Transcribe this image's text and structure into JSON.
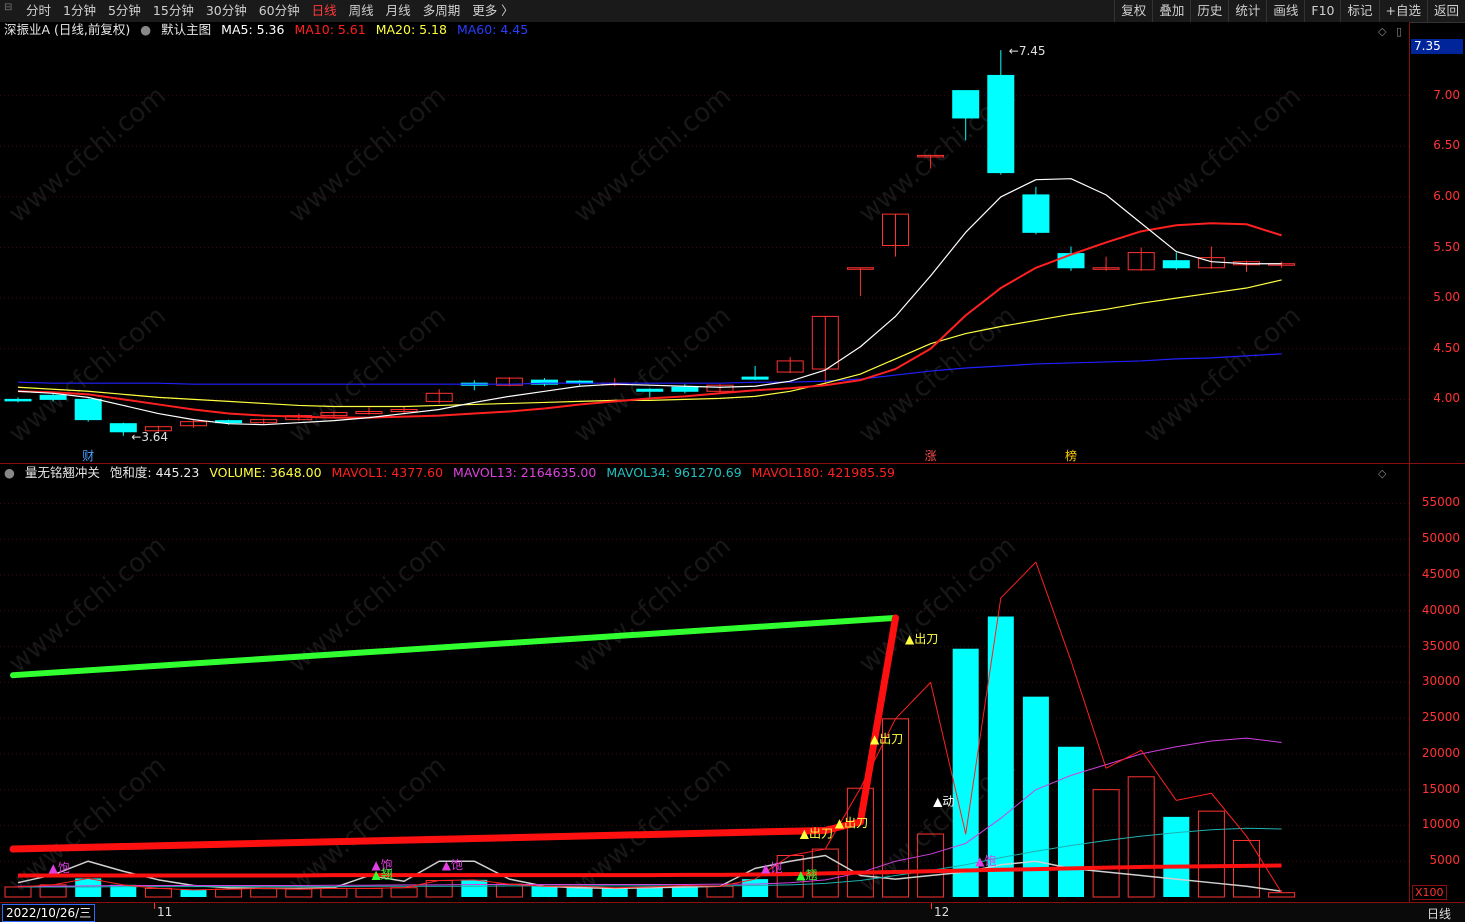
{
  "toolbar": {
    "timeframes": [
      "分时",
      "1分钟",
      "5分钟",
      "15分钟",
      "30分钟",
      "60分钟",
      "日线",
      "周线",
      "月线",
      "多周期",
      "更多 〉"
    ],
    "active": "日线",
    "right_buttons": [
      "复权",
      "叠加",
      "历史",
      "统计",
      "画线",
      "F10",
      "标记",
      "+自选",
      "返回"
    ]
  },
  "main_legend": {
    "stock": "深振业A (日线,前复权)",
    "chart_name": "默认主图",
    "ma5": "MA5: 5.36",
    "ma10": "MA10: 5.61",
    "ma20": "MA20: 5.18",
    "ma60": "MA60: 4.45"
  },
  "sub_legend": {
    "indicator": "量无铭翘冲关",
    "saturation": "饱和度: 445.23",
    "volume": "VOLUME: 3648.00",
    "mavol1": "MAVOL1: 4377.60",
    "mavol13": "MAVOL13: 2164635.00",
    "mavol34": "MAVOL34: 961270.69",
    "mavol180": "MAVOL180: 421985.59"
  },
  "price_axis": [
    "7.00",
    "6.50",
    "6.00",
    "5.50",
    "5.00",
    "4.50",
    "4.00"
  ],
  "last_price": "7.35",
  "volume_axis": [
    "55000",
    "50000",
    "45000",
    "40000",
    "35000",
    "30000",
    "25000",
    "20000",
    "15000",
    "10000",
    "5000"
  ],
  "volume_unit": "X100",
  "annotations": {
    "high": "7.45",
    "low": "3.64",
    "marks": [
      "财",
      "涨",
      "榜"
    ],
    "sig_chudao": "出刀",
    "sig_dong": "动",
    "sig_bao": "饱",
    "sig_qiao": "翘"
  },
  "dates": {
    "current": "2022/10/26/三",
    "m11": "11",
    "m12": "12"
  },
  "period_label": "日线",
  "watermark": "www.cfchi.com",
  "colors": {
    "up": "#ff3232",
    "down": "#00ffff",
    "ma5": "#ffffff",
    "ma10": "#ff2020",
    "ma20": "#ffff40",
    "ma60": "#2020ff"
  },
  "chart_data": {
    "type": "candlestick",
    "price_candles": [
      {
        "o": 4.0,
        "c": 3.99,
        "h": 4.02,
        "l": 3.97
      },
      {
        "o": 4.04,
        "c": 4.0,
        "h": 4.06,
        "l": 3.98
      },
      {
        "o": 4.0,
        "c": 3.8,
        "h": 4.01,
        "l": 3.78
      },
      {
        "o": 3.76,
        "c": 3.68,
        "h": 3.77,
        "l": 3.64
      },
      {
        "o": 3.69,
        "c": 3.73,
        "h": 3.74,
        "l": 3.67
      },
      {
        "o": 3.74,
        "c": 3.78,
        "h": 3.8,
        "l": 3.72
      },
      {
        "o": 3.79,
        "c": 3.77,
        "h": 3.8,
        "l": 3.75
      },
      {
        "o": 3.77,
        "c": 3.8,
        "h": 3.81,
        "l": 3.75
      },
      {
        "o": 3.8,
        "c": 3.84,
        "h": 3.86,
        "l": 3.79
      },
      {
        "o": 3.84,
        "c": 3.87,
        "h": 3.88,
        "l": 3.82
      },
      {
        "o": 3.86,
        "c": 3.88,
        "h": 3.92,
        "l": 3.85
      },
      {
        "o": 3.88,
        "c": 3.9,
        "h": 3.93,
        "l": 3.86
      },
      {
        "o": 3.98,
        "c": 4.06,
        "h": 4.1,
        "l": 3.96
      },
      {
        "o": 4.16,
        "c": 4.14,
        "h": 4.19,
        "l": 4.09
      },
      {
        "o": 4.14,
        "c": 4.21,
        "h": 4.22,
        "l": 4.13
      },
      {
        "o": 4.19,
        "c": 4.15,
        "h": 4.21,
        "l": 4.13
      },
      {
        "o": 4.18,
        "c": 4.16,
        "h": 4.19,
        "l": 4.14
      },
      {
        "o": 4.15,
        "c": 4.16,
        "h": 4.21,
        "l": 4.13
      },
      {
        "o": 4.1,
        "c": 4.08,
        "h": 4.11,
        "l": 4.02
      },
      {
        "o": 4.12,
        "c": 4.08,
        "h": 4.15,
        "l": 4.06
      },
      {
        "o": 4.08,
        "c": 4.14,
        "h": 4.15,
        "l": 4.07
      },
      {
        "o": 4.22,
        "c": 4.2,
        "h": 4.33,
        "l": 4.19
      },
      {
        "o": 4.27,
        "c": 4.38,
        "h": 4.42,
        "l": 4.26
      },
      {
        "o": 4.3,
        "c": 4.82,
        "h": 4.82,
        "l": 4.15
      },
      {
        "o": 5.3,
        "c": 5.3,
        "h": 5.3,
        "l": 5.02
      },
      {
        "o": 5.52,
        "c": 5.83,
        "h": 5.83,
        "l": 5.41
      },
      {
        "o": 6.41,
        "c": 6.41,
        "h": 6.41,
        "l": 6.28
      },
      {
        "o": 7.05,
        "c": 6.78,
        "h": 7.05,
        "l": 6.56
      },
      {
        "o": 7.2,
        "c": 6.24,
        "h": 7.45,
        "l": 6.22
      },
      {
        "o": 6.02,
        "c": 5.65,
        "h": 6.1,
        "l": 5.63
      },
      {
        "o": 5.44,
        "c": 5.3,
        "h": 5.51,
        "l": 5.27
      },
      {
        "o": 5.29,
        "c": 5.3,
        "h": 5.41,
        "l": 5.27
      },
      {
        "o": 5.28,
        "c": 5.45,
        "h": 5.5,
        "l": 5.27
      },
      {
        "o": 5.37,
        "c": 5.3,
        "h": 5.45,
        "l": 5.28
      },
      {
        "o": 5.3,
        "c": 5.4,
        "h": 5.51,
        "l": 5.29
      },
      {
        "o": 5.33,
        "c": 5.36,
        "h": 5.37,
        "l": 5.26
      },
      {
        "o": 5.34,
        "c": 5.34,
        "h": 5.36,
        "l": 5.3
      }
    ],
    "ma5": [
      4.08,
      4.06,
      4.02,
      3.94,
      3.86,
      3.8,
      3.76,
      3.75,
      3.77,
      3.79,
      3.82,
      3.86,
      3.9,
      3.97,
      4.03,
      4.08,
      4.13,
      4.15,
      4.14,
      4.13,
      4.12,
      4.13,
      4.18,
      4.29,
      4.52,
      4.82,
      5.22,
      5.65,
      6.0,
      6.17,
      6.18,
      6.02,
      5.74,
      5.46,
      5.36,
      5.34,
      5.34
    ],
    "ma10": [
      4.08,
      4.07,
      4.05,
      4.0,
      3.95,
      3.9,
      3.86,
      3.84,
      3.83,
      3.82,
      3.82,
      3.83,
      3.84,
      3.86,
      3.88,
      3.91,
      3.95,
      3.98,
      4.01,
      4.03,
      4.06,
      4.09,
      4.11,
      4.14,
      4.19,
      4.3,
      4.5,
      4.83,
      5.1,
      5.3,
      5.43,
      5.55,
      5.66,
      5.72,
      5.74,
      5.73,
      5.62
    ],
    "ma20": [
      4.12,
      4.1,
      4.08,
      4.05,
      4.02,
      4.0,
      3.98,
      3.96,
      3.94,
      3.93,
      3.93,
      3.93,
      3.94,
      3.95,
      3.96,
      3.97,
      3.98,
      3.99,
      3.99,
      4.0,
      4.01,
      4.03,
      4.08,
      4.16,
      4.25,
      4.4,
      4.55,
      4.65,
      4.72,
      4.78,
      4.84,
      4.89,
      4.95,
      5.0,
      5.05,
      5.1,
      5.18
    ],
    "ma60": [
      4.17,
      4.16,
      4.16,
      4.16,
      4.16,
      4.15,
      4.15,
      4.15,
      4.15,
      4.15,
      4.15,
      4.15,
      4.15,
      4.15,
      4.15,
      4.16,
      4.16,
      4.16,
      4.16,
      4.16,
      4.16,
      4.17,
      4.17,
      4.18,
      4.2,
      4.24,
      4.28,
      4.31,
      4.33,
      4.35,
      4.36,
      4.37,
      4.38,
      4.4,
      4.41,
      4.43,
      4.45
    ],
    "volume": [
      {
        "v": 1400,
        "up": true
      },
      {
        "v": 1700,
        "up": true
      },
      {
        "v": 2600,
        "up": false
      },
      {
        "v": 1700,
        "up": false
      },
      {
        "v": 1200,
        "up": true
      },
      {
        "v": 1000,
        "up": false
      },
      {
        "v": 1100,
        "up": true
      },
      {
        "v": 1200,
        "up": true
      },
      {
        "v": 1100,
        "up": true
      },
      {
        "v": 1200,
        "up": true
      },
      {
        "v": 1200,
        "up": true
      },
      {
        "v": 1300,
        "up": true
      },
      {
        "v": 2300,
        "up": true
      },
      {
        "v": 2400,
        "up": false
      },
      {
        "v": 1800,
        "up": true
      },
      {
        "v": 1500,
        "up": false
      },
      {
        "v": 1500,
        "up": false
      },
      {
        "v": 1300,
        "up": false
      },
      {
        "v": 1400,
        "up": false
      },
      {
        "v": 1600,
        "up": false
      },
      {
        "v": 1500,
        "up": true
      },
      {
        "v": 2500,
        "up": false
      },
      {
        "v": 5800,
        "up": true
      },
      {
        "v": 6700,
        "up": true
      },
      {
        "v": 15200,
        "up": true
      },
      {
        "v": 24900,
        "up": true
      },
      {
        "v": 8800,
        "up": true
      },
      {
        "v": 34700,
        "up": false
      },
      {
        "v": 39200,
        "up": false
      },
      {
        "v": 28000,
        "up": false
      },
      {
        "v": 21000,
        "up": false
      },
      {
        "v": 15000,
        "up": true
      },
      {
        "v": 16800,
        "up": true
      },
      {
        "v": 11200,
        "up": false
      },
      {
        "v": 12000,
        "up": true
      },
      {
        "v": 7900,
        "up": true
      },
      {
        "v": 600,
        "up": true
      }
    ],
    "mavol1": [
      1400,
      1700,
      2600,
      1700,
      1200,
      1000,
      1100,
      1200,
      1100,
      1200,
      1200,
      1300,
      2300,
      2400,
      1800,
      1500,
      1500,
      1300,
      1400,
      1600,
      1500,
      2500,
      5800,
      6700,
      15200,
      24900,
      30000,
      8800,
      41800,
      46800,
      33000,
      18000,
      20500,
      13500,
      14500,
      8500,
      600
    ],
    "mavol_magenta": [
      1500,
      1500,
      1550,
      1600,
      1600,
      1600,
      1600,
      1600,
      1600,
      1650,
      1650,
      1700,
      1700,
      1750,
      1750,
      1750,
      1750,
      1750,
      1750,
      1750,
      1800,
      1800,
      2000,
      2400,
      3400,
      5000,
      6000,
      7500,
      11000,
      15000,
      17000,
      18500,
      20000,
      21000,
      21800,
      22200,
      21600
    ],
    "mavol_cyan": [
      1400,
      1400,
      1400,
      1450,
      1450,
      1450,
      1450,
      1450,
      1450,
      1450,
      1500,
      1500,
      1500,
      1500,
      1550,
      1550,
      1550,
      1550,
      1550,
      1550,
      1550,
      1600,
      1700,
      1900,
      2300,
      3000,
      3700,
      4500,
      5500,
      6400,
      7200,
      7900,
      8500,
      9000,
      9400,
      9600,
      9500
    ],
    "mavol180": [
      3000,
      3000,
      3000,
      3000,
      3000,
      3000,
      3000,
      3000,
      3000,
      3050,
      3050,
      3050,
      3050,
      3050,
      3050,
      3050,
      3050,
      3050,
      3050,
      3100,
      3100,
      3150,
      3200,
      3300,
      3400,
      3500,
      3600,
      3700,
      3800,
      3900,
      4000,
      4100,
      4200,
      4250,
      4300,
      4350,
      4400
    ],
    "white_line": [
      2000,
      3100,
      5000,
      3600,
      2400,
      1600,
      1300,
      1200,
      1200,
      1300,
      3000,
      2200,
      5000,
      5000,
      2500,
      1500,
      1300,
      1200,
      1300,
      1400,
      1500,
      4000,
      5000,
      5800,
      3000,
      2500,
      3000,
      3500,
      4500,
      5000,
      4000,
      3500,
      3000,
      2500,
      2000,
      1500,
      800
    ],
    "green_line": {
      "start": 31000,
      "end": 39000,
      "i_start": 0,
      "i_end": 25
    },
    "red_thick": [
      {
        "i": 0,
        "v": 6700
      },
      {
        "i": 23,
        "v": 9300
      },
      {
        "i": 24,
        "v": 10500
      },
      {
        "i": 25,
        "v": 39000
      }
    ],
    "price_ylim": [
      3.5,
      7.55
    ],
    "vol_ylim": [
      0,
      58000
    ]
  }
}
